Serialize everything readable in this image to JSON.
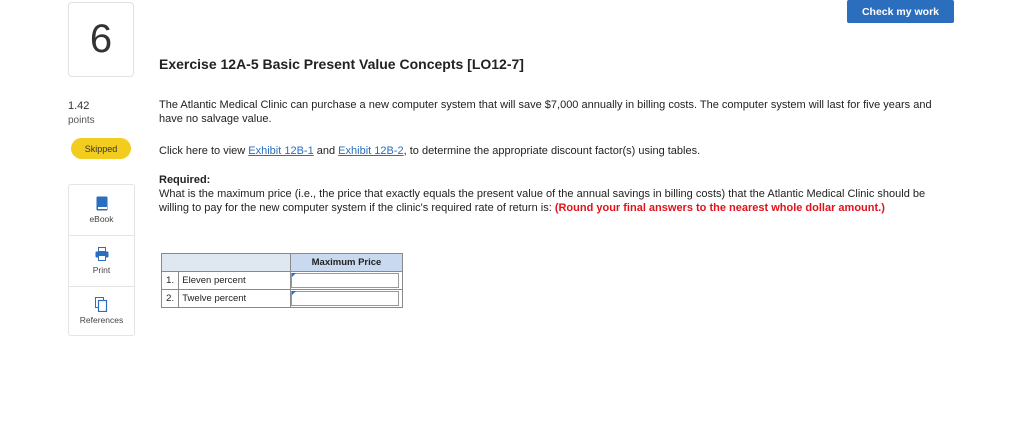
{
  "question": {
    "number": "6",
    "points_value": "1.42",
    "points_label": "points",
    "status_badge": "Skipped"
  },
  "tools": [
    {
      "label": "eBook",
      "icon": "book-icon"
    },
    {
      "label": "Print",
      "icon": "printer-icon"
    },
    {
      "label": "References",
      "icon": "references-icon"
    }
  ],
  "header": {
    "check_button": "Check my work"
  },
  "content": {
    "title": "Exercise 12A-5 Basic Present Value Concepts [LO12-7]",
    "intro": "The Atlantic Medical Clinic can purchase a new computer system that will save $7,000 annually in billing costs. The computer system will last for five years and have no salvage value.",
    "exhibit_prefix": "Click here to view ",
    "exhibit_link_1": "Exhibit 12B-1",
    "exhibit_and": " and ",
    "exhibit_link_2": "Exhibit 12B-2",
    "exhibit_suffix": ", to determine the appropriate discount factor(s) using tables.",
    "required_label": "Required:",
    "required_text": "What is the maximum price (i.e., the price that exactly equals the present value of the annual savings in billing costs) that the Atlantic Medical Clinic should be willing to pay for the new computer system if the clinic's required rate of return is: ",
    "required_note": "(Round your final answers to the nearest whole dollar amount.)"
  },
  "answer_table": {
    "header": "Maximum Price",
    "rows": [
      {
        "num": "1.",
        "label": "Eleven percent",
        "value": ""
      },
      {
        "num": "2.",
        "label": "Twelve percent",
        "value": ""
      }
    ]
  },
  "colors": {
    "accent": "#2a6ebd",
    "badge": "#f2cd1f",
    "note_red": "#e0131b",
    "table_header": "#c9d9ef"
  }
}
